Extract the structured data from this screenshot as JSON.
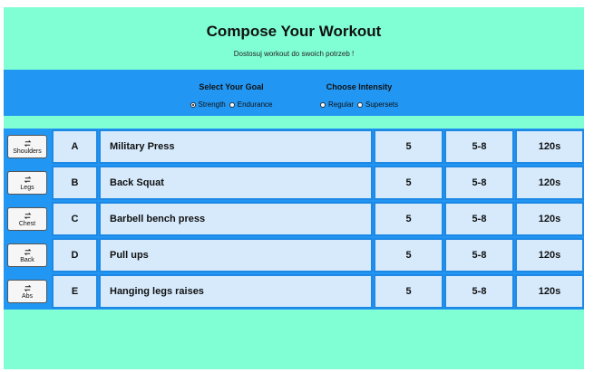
{
  "header": {
    "title": "Compose Your Workout",
    "subtitle": "Dostosuj workout do swoich potrzeb !"
  },
  "options": {
    "goal": {
      "label": "Select Your Goal",
      "choices": [
        {
          "label": "Strength",
          "selected": true
        },
        {
          "label": "Endurance",
          "selected": false
        }
      ]
    },
    "intensity": {
      "label": "Choose Intensity",
      "choices": [
        {
          "label": "Regular",
          "selected": false
        },
        {
          "label": "Supersets",
          "selected": false
        }
      ]
    }
  },
  "exercises": [
    {
      "muscle": "Shoulders",
      "letter": "A",
      "name": "Military Press",
      "sets": "5",
      "reps": "5-8",
      "rest": "120s"
    },
    {
      "muscle": "Legs",
      "letter": "B",
      "name": "Back Squat",
      "sets": "5",
      "reps": "5-8",
      "rest": "120s"
    },
    {
      "muscle": "Chest",
      "letter": "C",
      "name": "Barbell bench press",
      "sets": "5",
      "reps": "5-8",
      "rest": "120s"
    },
    {
      "muscle": "Back",
      "letter": "D",
      "name": "Pull ups",
      "sets": "5",
      "reps": "5-8",
      "rest": "120s"
    },
    {
      "muscle": "Abs",
      "letter": "E",
      "name": "Hanging legs raises",
      "sets": "5",
      "reps": "5-8",
      "rest": "120s"
    }
  ],
  "icons": {
    "swap": "swap-arrows-icon"
  },
  "colors": {
    "background": "#80ffd4",
    "accent": "#2196f3",
    "cell": "#d6eafc"
  }
}
